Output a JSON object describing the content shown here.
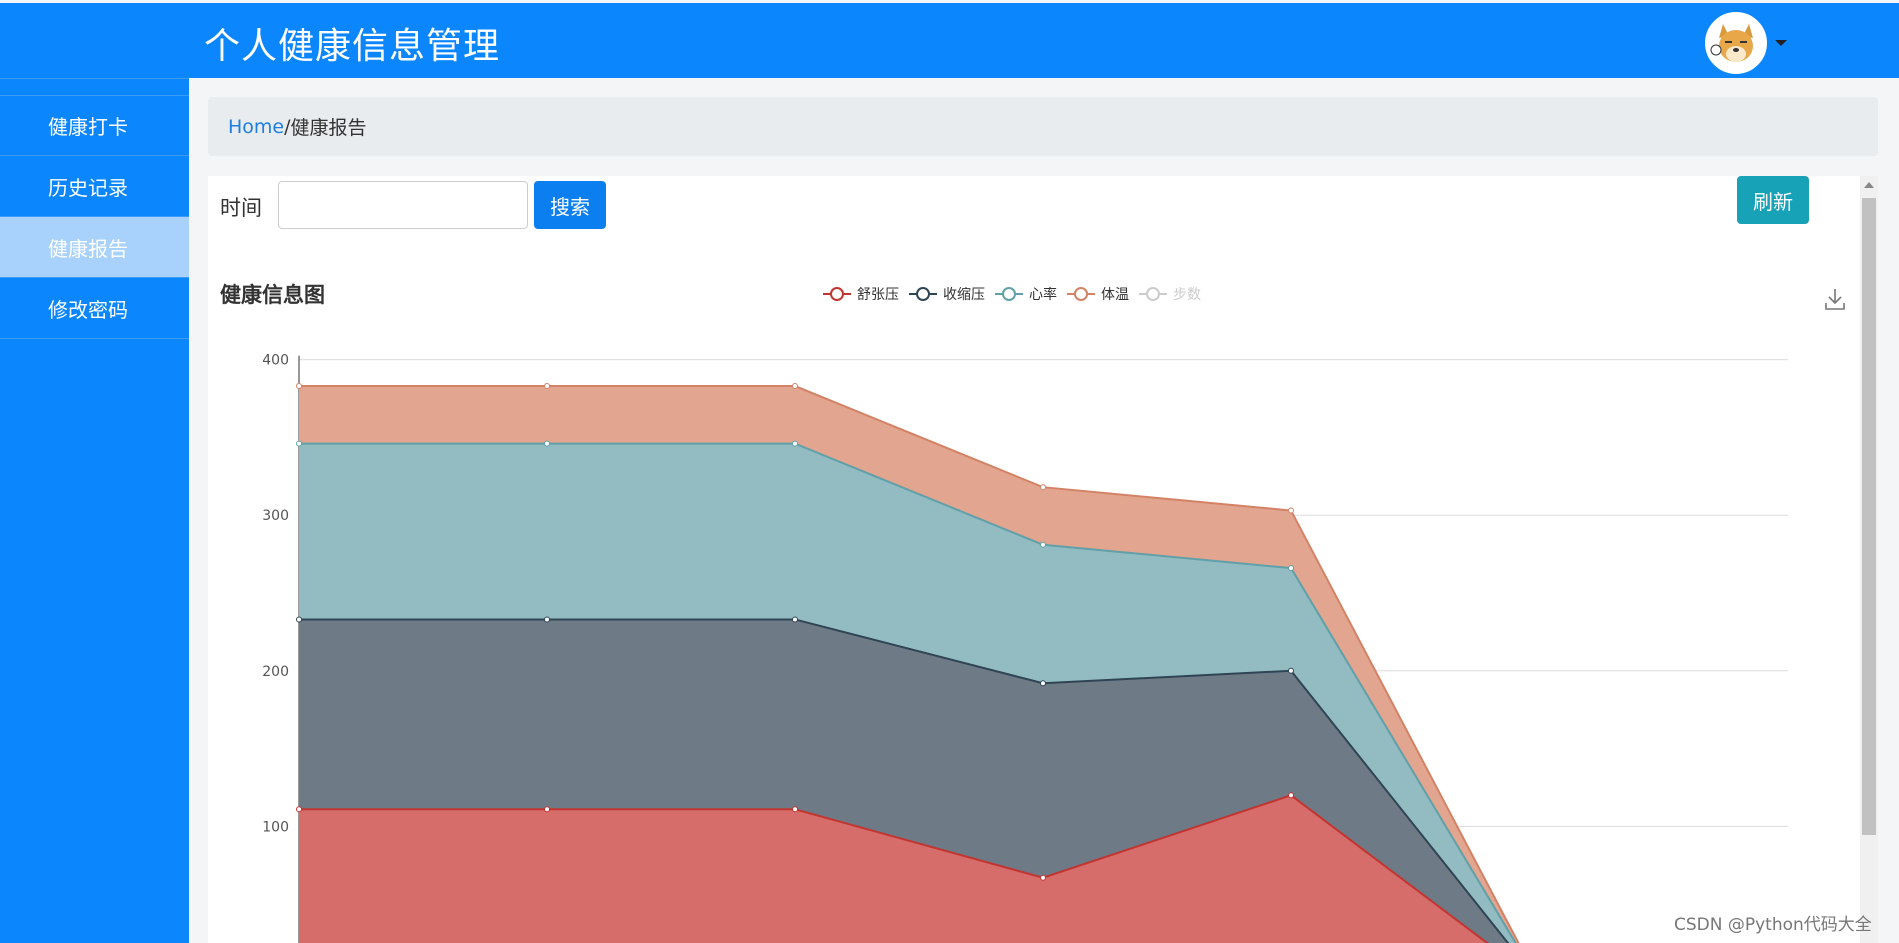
{
  "header": {
    "title": "个人健康信息管理"
  },
  "sidebar": {
    "items": [
      {
        "label": "健康打卡"
      },
      {
        "label": "历史记录"
      },
      {
        "label": "健康报告"
      },
      {
        "label": "修改密码"
      }
    ]
  },
  "breadcrumb": {
    "home": "Home",
    "separator": "/",
    "current": "健康报告"
  },
  "search": {
    "label": "时间",
    "value": "",
    "button": "搜索"
  },
  "refresh_button": "刷新",
  "watermark": "CSDN @Python代码大全",
  "chart_data": {
    "type": "area",
    "stacked": true,
    "title": "健康信息图",
    "x": [
      "",
      "",
      "",
      "",
      "",
      "",
      ""
    ],
    "ylim": [
      0,
      400
    ],
    "yticks": [
      100,
      200,
      300,
      400
    ],
    "grid": true,
    "legend_position": "top-center",
    "series": [
      {
        "name": "舒张压",
        "color": "#c23531",
        "values": [
          111,
          111,
          111,
          67,
          120,
          0,
          0
        ]
      },
      {
        "name": "收缩压",
        "color": "#2f4554",
        "values": [
          122,
          122,
          122,
          125,
          80,
          0,
          0
        ]
      },
      {
        "name": "心率",
        "color": "#61a0a8",
        "values": [
          113,
          113,
          113,
          89,
          66,
          0,
          0
        ]
      },
      {
        "name": "体温",
        "color": "#d48265",
        "values": [
          37,
          37,
          37,
          37,
          37,
          0,
          0
        ]
      },
      {
        "name": "步数",
        "color": "#cccccc",
        "values": [],
        "hidden": true
      }
    ]
  }
}
